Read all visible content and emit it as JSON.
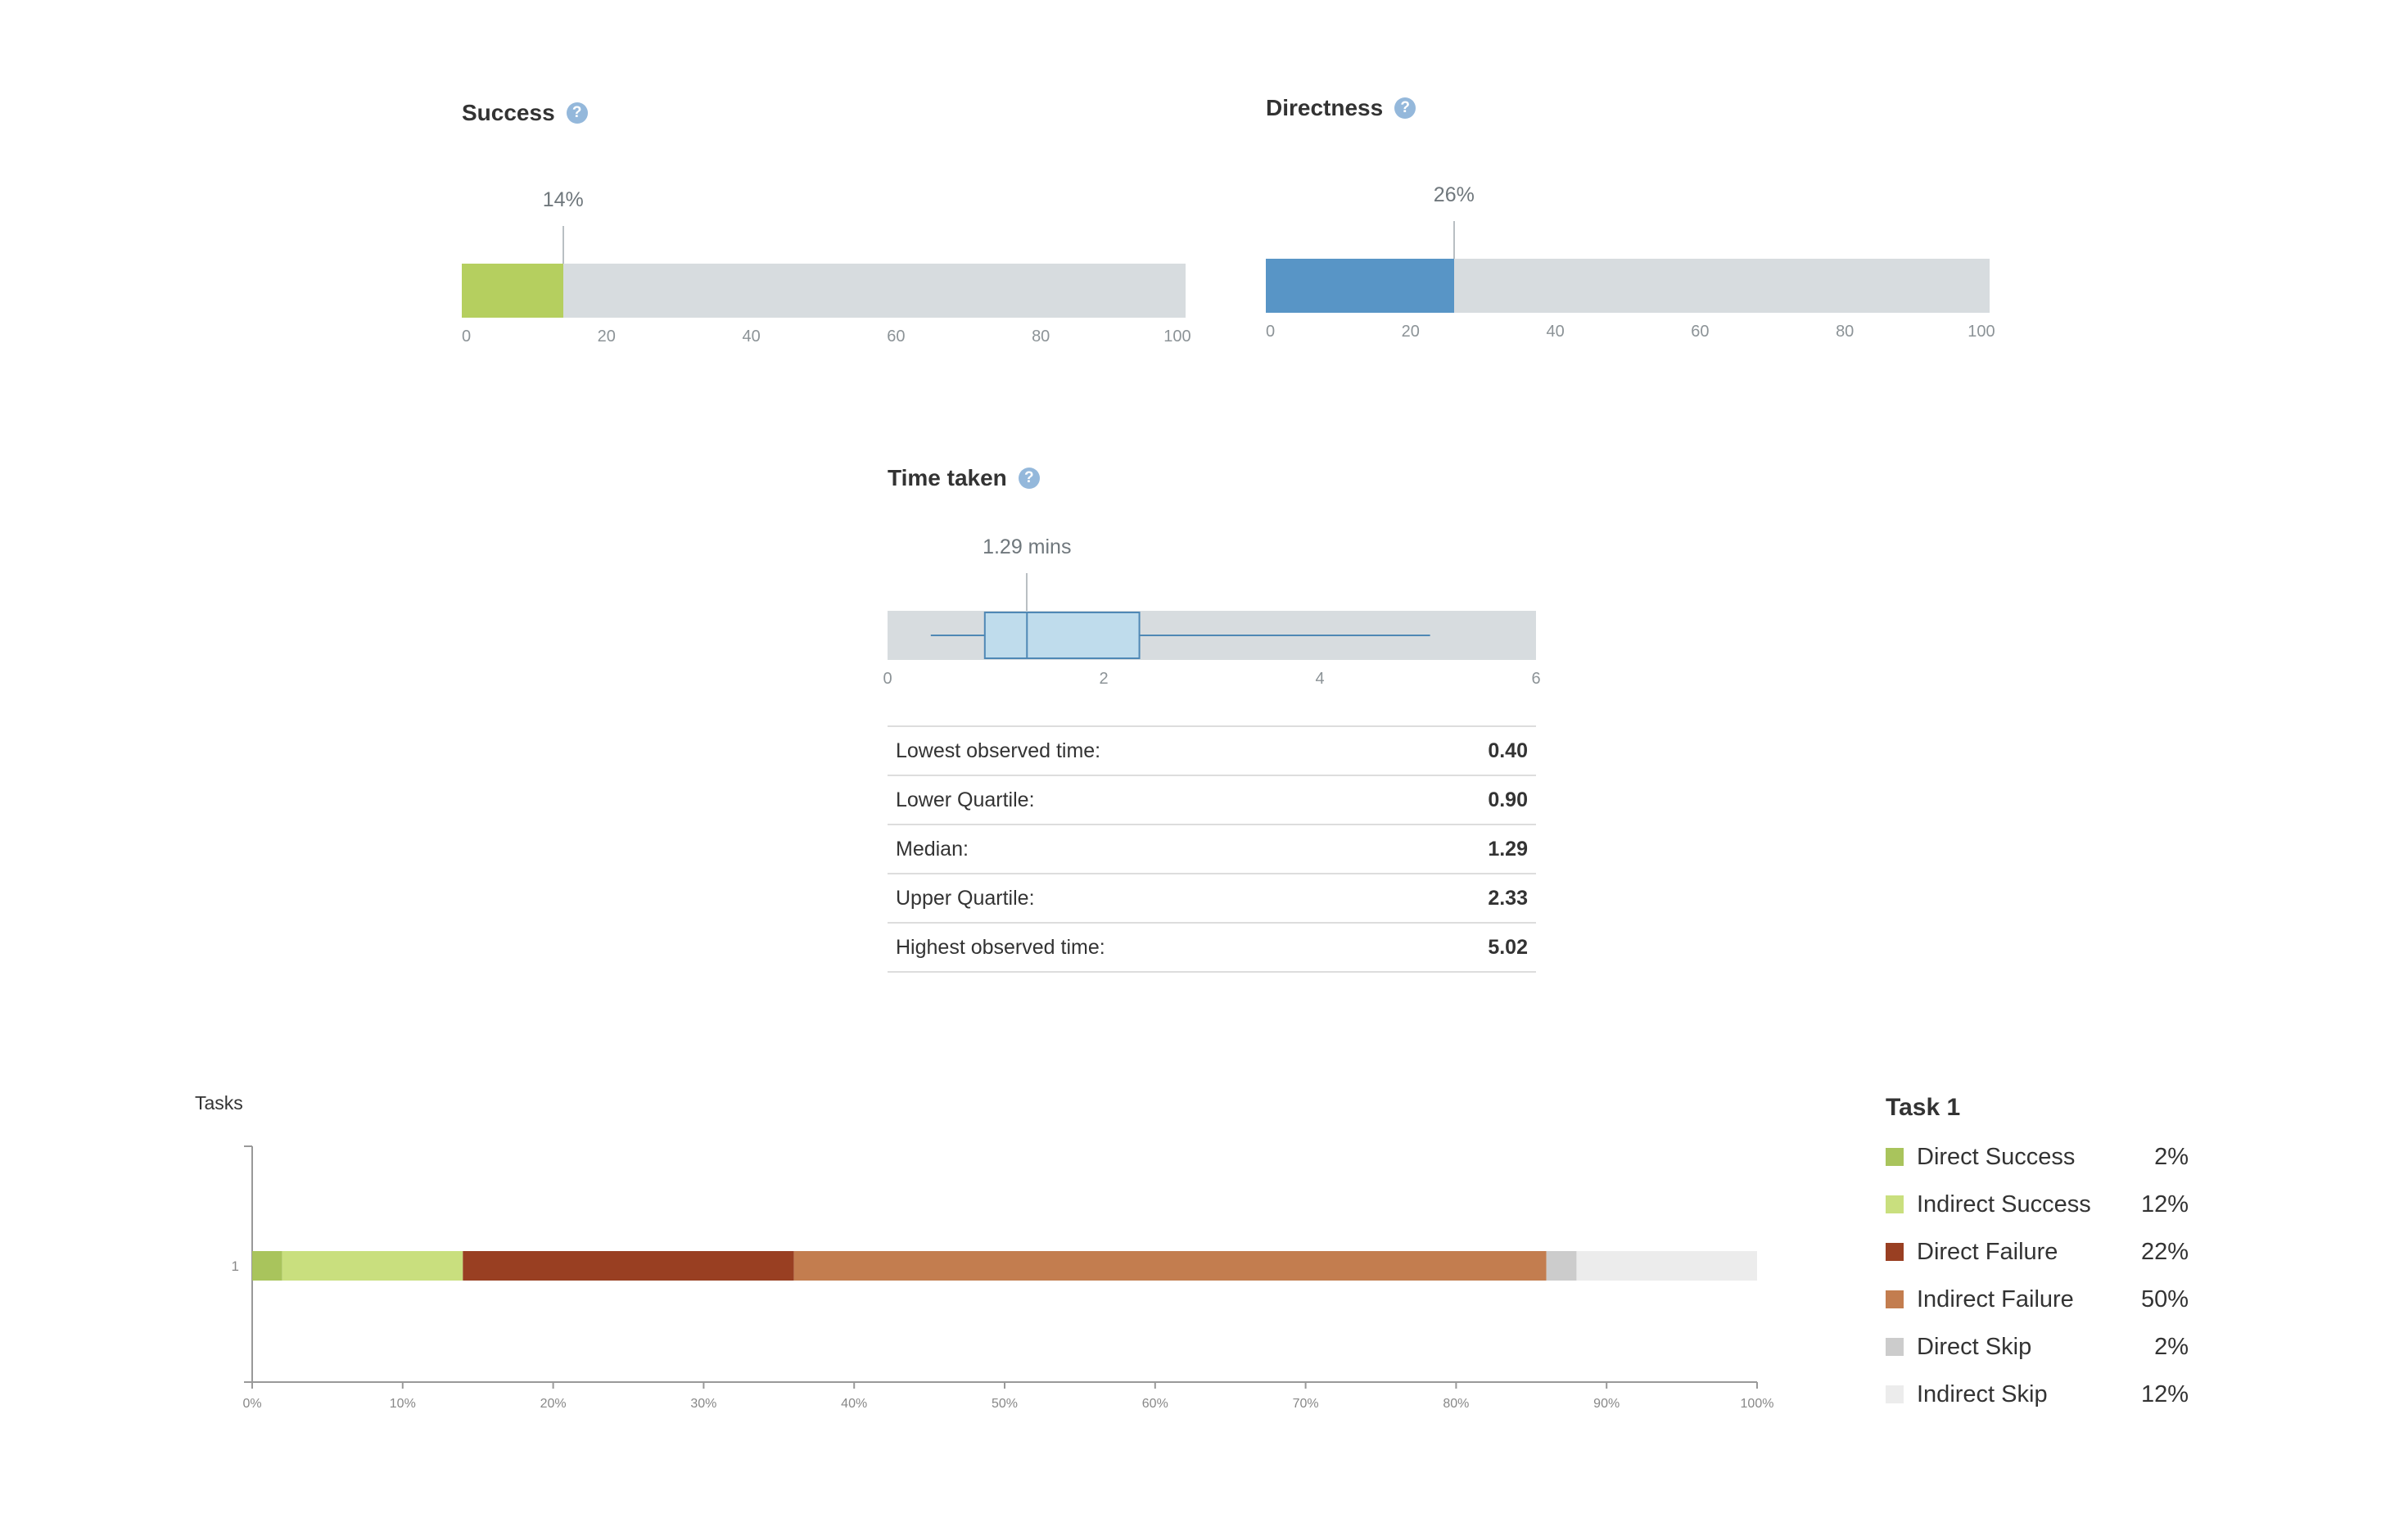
{
  "success": {
    "title": "Success",
    "help_icon": "help-icon",
    "value": 14,
    "value_label": "14%",
    "color": "#b5cf5f",
    "ticks": [
      "0",
      "20",
      "40",
      "60",
      "80",
      "100"
    ]
  },
  "directness": {
    "title": "Directness",
    "help_icon": "help-icon",
    "value": 26,
    "value_label": "26%",
    "color": "#5895c6",
    "ticks": [
      "0",
      "20",
      "40",
      "60",
      "80",
      "100"
    ]
  },
  "time_taken": {
    "title": "Time taken",
    "help_icon": "help-icon",
    "median_label": "1.29 mins",
    "ticks": [
      "0",
      "2",
      "4",
      "6"
    ],
    "stats": [
      {
        "label": "Lowest observed time:",
        "value": "0.40"
      },
      {
        "label": "Lower Quartile:",
        "value": "0.90"
      },
      {
        "label": "Median:",
        "value": "1.29"
      },
      {
        "label": "Upper Quartile:",
        "value": "2.33"
      },
      {
        "label": "Highest observed time:",
        "value": "5.02"
      }
    ]
  },
  "tasks_chart": {
    "y_title": "Tasks",
    "category": "1",
    "x_ticks": [
      "0%",
      "10%",
      "20%",
      "30%",
      "40%",
      "50%",
      "60%",
      "70%",
      "80%",
      "90%",
      "100%"
    ]
  },
  "legend": {
    "title": "Task 1",
    "items": [
      {
        "label": "Direct Success",
        "value": "2%"
      },
      {
        "label": "Indirect Success",
        "value": "12%"
      },
      {
        "label": "Direct Failure",
        "value": "22%"
      },
      {
        "label": "Indirect Failure",
        "value": "50%"
      },
      {
        "label": "Direct Skip",
        "value": "2%"
      },
      {
        "label": "Indirect Skip",
        "value": "12%"
      }
    ]
  },
  "chart_data": [
    {
      "type": "bar",
      "title": "Success",
      "categories": [
        "Success"
      ],
      "values": [
        14
      ],
      "xlim": [
        0,
        100
      ]
    },
    {
      "type": "bar",
      "title": "Directness",
      "categories": [
        "Directness"
      ],
      "values": [
        26
      ],
      "xlim": [
        0,
        100
      ]
    },
    {
      "type": "box",
      "title": "Time taken",
      "min": 0.4,
      "q1": 0.9,
      "median": 1.29,
      "q3": 2.33,
      "max": 5.02,
      "xlim": [
        0,
        6
      ]
    },
    {
      "type": "bar",
      "stacked": true,
      "orientation": "horizontal",
      "ylabel": "Tasks",
      "categories": [
        "1"
      ],
      "series": [
        {
          "name": "Direct Success",
          "values": [
            2
          ],
          "color": "#a9c45c"
        },
        {
          "name": "Indirect Success",
          "values": [
            12
          ],
          "color": "#c9df7e"
        },
        {
          "name": "Direct Failure",
          "values": [
            22
          ],
          "color": "#993f22"
        },
        {
          "name": "Indirect Failure",
          "values": [
            50
          ],
          "color": "#c37d4f"
        },
        {
          "name": "Direct Skip",
          "values": [
            2
          ],
          "color": "#cccccc"
        },
        {
          "name": "Indirect Skip",
          "values": [
            12
          ],
          "color": "#ececec"
        }
      ],
      "xlim": [
        0,
        100
      ],
      "legend_position": "right"
    }
  ]
}
